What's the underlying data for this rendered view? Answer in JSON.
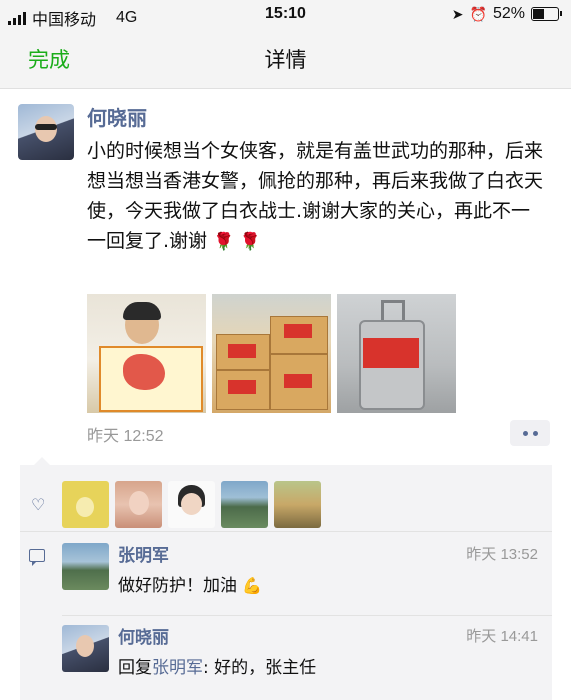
{
  "status_bar": {
    "carrier": "中国移动",
    "network": "4G",
    "time": "15:10",
    "battery": "52%",
    "battery_level": 0.52
  },
  "nav": {
    "done_label": "完成",
    "title": "详情"
  },
  "post": {
    "author": "何晓丽",
    "text": "小的时候想当个女侠客，就是有盖世武功的那种，后来想当想当香港女警，佩抢的那种，再后来我做了白衣天使，今天我做了白衣战士.谢谢大家的关心，再此不一一回复了.谢谢",
    "emoji": "🌹 🌹",
    "timestamp": "昨天 12:52"
  },
  "comments": [
    {
      "author": "张明军",
      "time": "昨天 13:52",
      "text": "做好防护！加油",
      "emoji": "💪"
    },
    {
      "author": "何晓丽",
      "time": "昨天 14:41",
      "reply_prefix": "回复",
      "reply_to": "张明军",
      "text": ": 好的，张主任"
    }
  ],
  "colors": {
    "accent_green": "#1aad19",
    "name_blue": "#576b95",
    "muted_gray": "#999999"
  }
}
